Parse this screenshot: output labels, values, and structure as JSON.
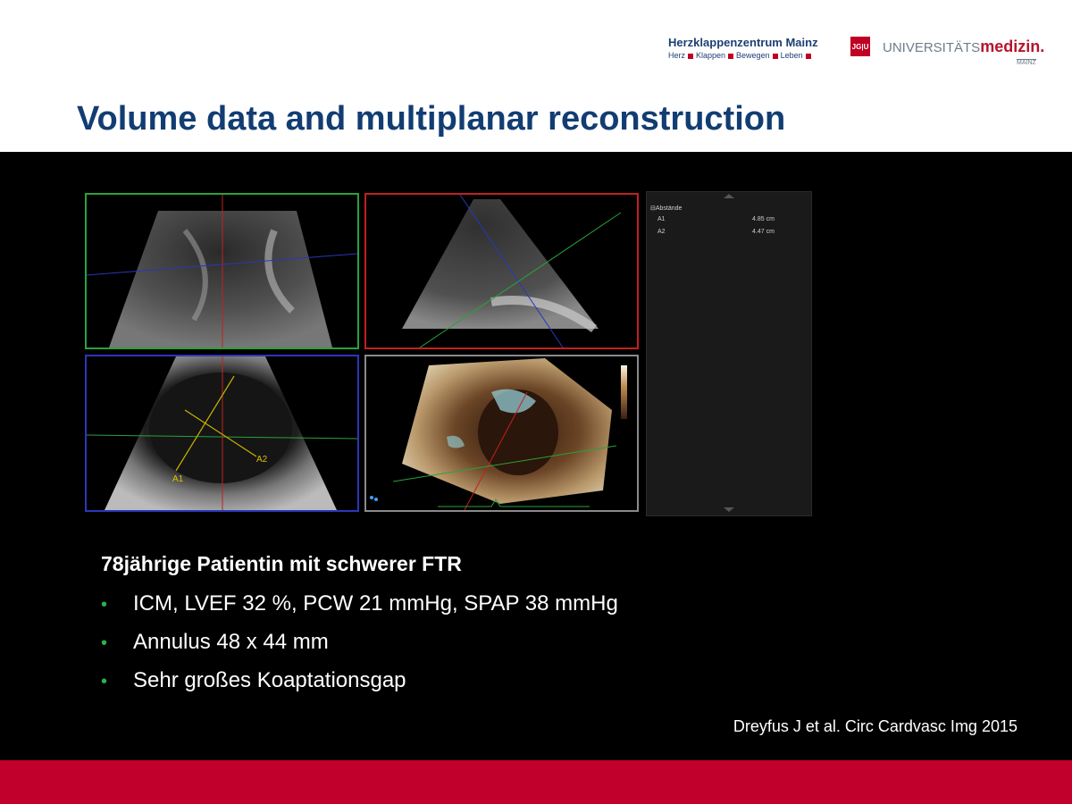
{
  "header": {
    "logo_name": "Herzklappenzentrum Mainz",
    "logo_tagline_words": [
      "Herz",
      "Klappen",
      "Bewegen",
      "Leben"
    ],
    "jgu_mark": "JG|U",
    "uni_prefix": "UNIVERSITÄTS",
    "uni_bold": "medizin.",
    "uni_city": "MAINZ",
    "accent_red": "#c00022",
    "brand_blue": "#123d73"
  },
  "slide": {
    "title": "Volume data and multiplanar reconstruction"
  },
  "measurements": {
    "header": "Abstände",
    "rows": [
      {
        "label": "A1",
        "value": "4.85 cm"
      },
      {
        "label": "A2",
        "value": "4.47 cm"
      }
    ]
  },
  "images": {
    "labels": {
      "a1": "A1",
      "a2": "A2"
    },
    "icons": [
      "echo-green-plane-icon",
      "echo-red-plane-icon",
      "echo-blue-plane-icon",
      "3d-render-icon"
    ]
  },
  "case": {
    "heading": "78jährige Patientin mit schwerer FTR",
    "bullets": [
      "ICM, LVEF 32 %, PCW 21 mmHg, SPAP 38 mmHg",
      "Annulus 48 x 44 mm",
      "Sehr großes Koaptationsgap"
    ]
  },
  "reference": "Dreyfus J et al. Circ Cardvasc Img  2015",
  "colors": {
    "footer": "#c1002b",
    "bullet": "#2bb24a"
  }
}
